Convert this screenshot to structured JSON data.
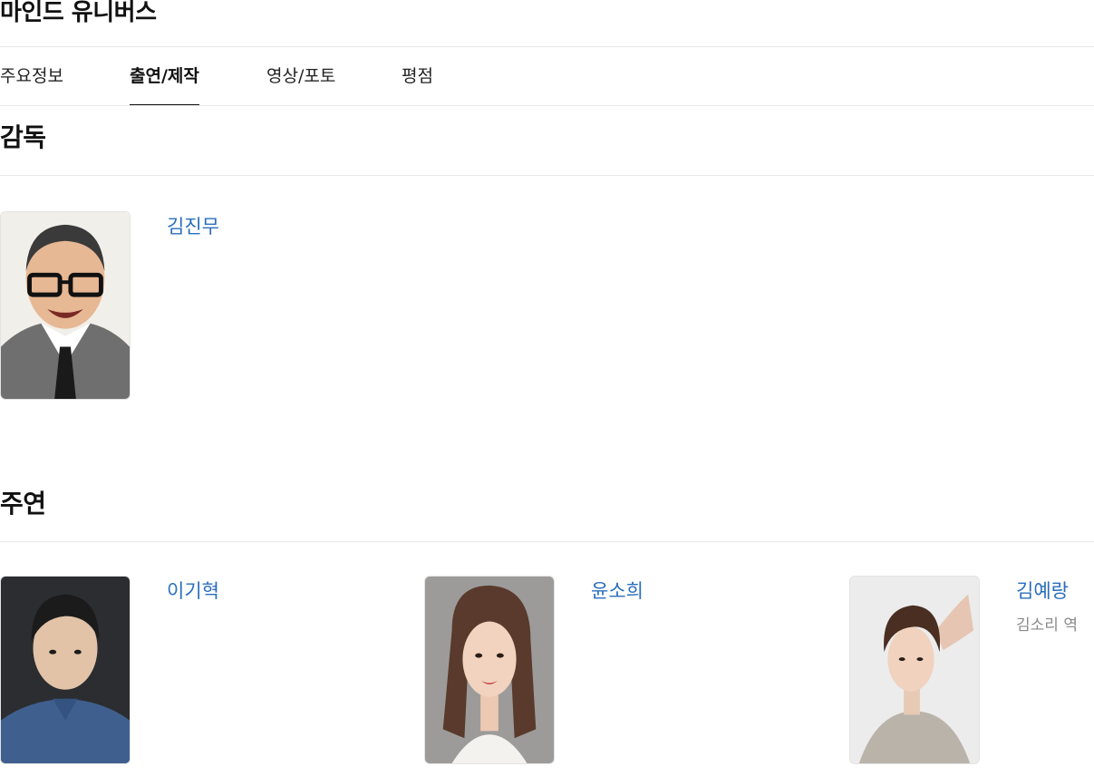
{
  "page": {
    "title": "마인드 유니버스"
  },
  "tabs": [
    {
      "label": "주요정보",
      "active": false
    },
    {
      "label": "출연/제작",
      "active": true
    },
    {
      "label": "영상/포토",
      "active": false
    },
    {
      "label": "평점",
      "active": false
    }
  ],
  "director_section": {
    "title": "감독",
    "people": [
      {
        "name": "김진무"
      }
    ]
  },
  "cast_section": {
    "title": "주연",
    "people": [
      {
        "name": "이기혁"
      },
      {
        "name": "윤소희"
      },
      {
        "name": "김예랑",
        "role": "김소리 역"
      }
    ]
  },
  "colors": {
    "link": "#2a6ebc",
    "divider": "#e8e8e8",
    "role_text": "#8a8a8a"
  }
}
